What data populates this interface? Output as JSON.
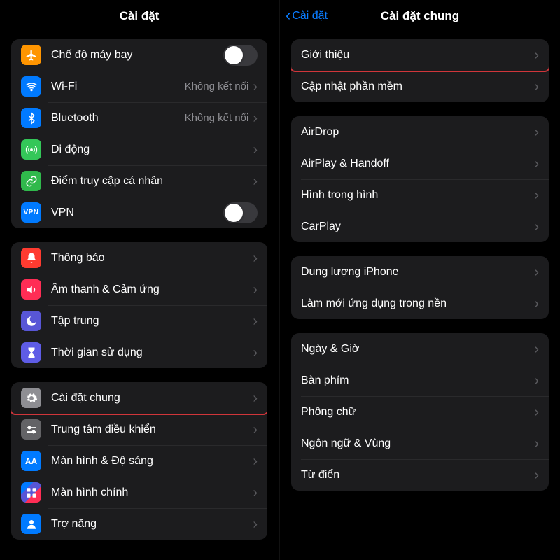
{
  "left": {
    "title": "Cài đặt",
    "groups": [
      [
        {
          "key": "airplane",
          "label": "Chế độ máy bay",
          "type": "toggle",
          "on": false,
          "iconColor": "c-orange",
          "icon": "airplane"
        },
        {
          "key": "wifi",
          "label": "Wi-Fi",
          "type": "detail",
          "detail": "Không kết nối",
          "iconColor": "c-blue",
          "icon": "wifi"
        },
        {
          "key": "bluetooth",
          "label": "Bluetooth",
          "type": "detail",
          "detail": "Không kết nối",
          "iconColor": "c-bluet",
          "icon": "bluetooth"
        },
        {
          "key": "cellular",
          "label": "Di động",
          "type": "nav",
          "iconColor": "c-green",
          "icon": "antenna"
        },
        {
          "key": "hotspot",
          "label": "Điểm truy cập cá nhân",
          "type": "nav",
          "iconColor": "c-greend",
          "icon": "link"
        },
        {
          "key": "vpn",
          "label": "VPN",
          "type": "toggle",
          "on": false,
          "iconColor": "c-vpn",
          "iconText": "VPN"
        }
      ],
      [
        {
          "key": "notifications",
          "label": "Thông báo",
          "type": "nav",
          "iconColor": "c-red",
          "icon": "bell"
        },
        {
          "key": "sounds",
          "label": "Âm thanh & Cảm ứng",
          "type": "nav",
          "iconColor": "c-pink",
          "icon": "speaker"
        },
        {
          "key": "focus",
          "label": "Tập trung",
          "type": "nav",
          "iconColor": "c-purple",
          "icon": "moon"
        },
        {
          "key": "screentime",
          "label": "Thời gian sử dụng",
          "type": "nav",
          "iconColor": "c-indigo",
          "icon": "hourglass"
        }
      ],
      [
        {
          "key": "general",
          "label": "Cài đặt chung",
          "type": "nav",
          "iconColor": "c-gray",
          "icon": "gear",
          "highlighted": true
        },
        {
          "key": "control",
          "label": "Trung tâm điều khiển",
          "type": "nav",
          "iconColor": "c-grayd",
          "icon": "sliders"
        },
        {
          "key": "display",
          "label": "Màn hình & Độ sáng",
          "type": "nav",
          "iconColor": "c-bluea",
          "iconText": "AA"
        },
        {
          "key": "home",
          "label": "Màn hình chính",
          "type": "nav",
          "iconColor": "c-multic",
          "icon": "grid"
        },
        {
          "key": "support",
          "label": "Trợ năng",
          "type": "nav",
          "iconColor": "c-blue",
          "icon": "person"
        }
      ]
    ]
  },
  "right": {
    "back": "Cài đặt",
    "title": "Cài đặt chung",
    "groups": [
      [
        {
          "key": "about",
          "label": "Giới thiệu",
          "type": "nav",
          "highlighted": true
        },
        {
          "key": "update",
          "label": "Cập nhật phần mềm",
          "type": "nav"
        }
      ],
      [
        {
          "key": "airdrop",
          "label": "AirDrop",
          "type": "nav"
        },
        {
          "key": "airplay",
          "label": "AirPlay & Handoff",
          "type": "nav"
        },
        {
          "key": "pip",
          "label": "Hình trong hình",
          "type": "nav"
        },
        {
          "key": "carplay",
          "label": "CarPlay",
          "type": "nav"
        }
      ],
      [
        {
          "key": "storage",
          "label": "Dung lượng iPhone",
          "type": "nav"
        },
        {
          "key": "bgapp",
          "label": "Làm mới ứng dụng trong nền",
          "type": "nav"
        }
      ],
      [
        {
          "key": "datetime",
          "label": "Ngày & Giờ",
          "type": "nav"
        },
        {
          "key": "keyboard",
          "label": "Bàn phím",
          "type": "nav"
        },
        {
          "key": "fonts",
          "label": "Phông chữ",
          "type": "nav"
        },
        {
          "key": "lang",
          "label": "Ngôn ngữ & Vùng",
          "type": "nav"
        },
        {
          "key": "dict",
          "label": "Từ điển",
          "type": "nav"
        }
      ]
    ]
  }
}
